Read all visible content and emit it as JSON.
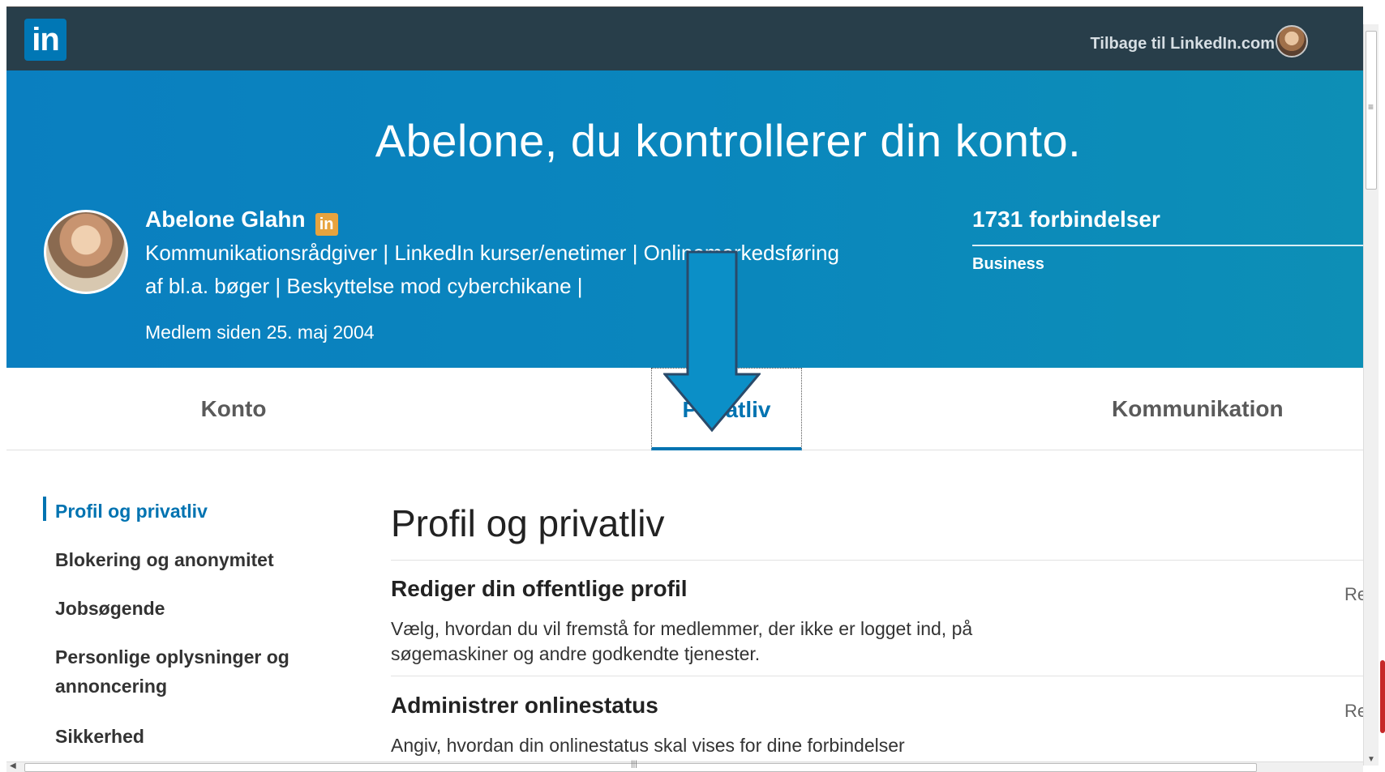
{
  "nav": {
    "logo_text": "in",
    "back_link": "Tilbage til LinkedIn.com",
    "avatar_icon": "user-avatar"
  },
  "hero": {
    "title": "Abelone, du kontrollerer din konto.",
    "name": "Abelone Glahn",
    "badge_text": "in",
    "headline_line1": "Kommunikationsrådgiver | LinkedIn kurser/enetimer | Onlinemarkedsføring",
    "headline_line2": "af bl.a. bøger | Beskyttelse mod cyberchikane |",
    "member_since": "Medlem siden 25. maj 2004",
    "connections": "1731 forbindelser",
    "account_type": "Business"
  },
  "tabs": [
    {
      "label": "Konto"
    },
    {
      "label": "Privatliv"
    },
    {
      "label": "Kommunikation"
    }
  ],
  "sidebar": {
    "items": [
      {
        "label": "Profil og privatliv"
      },
      {
        "label": "Blokering og anonymitet"
      },
      {
        "label": "Jobsøgende"
      },
      {
        "label": "Personlige oplysninger og annoncering"
      },
      {
        "label": "Sikkerhed"
      }
    ]
  },
  "main": {
    "title": "Profil og privatliv",
    "sections": [
      {
        "title": "Rediger din offentlige profil",
        "description": "Vælg, hvordan du vil fremstå for medlemmer, der ikke er logget ind, på søgemaskiner og andre godkendte tjenester.",
        "action": "Re"
      },
      {
        "title": "Administrer onlinestatus",
        "description": "Angiv, hvordan din onlinestatus skal vises for dine forbindelser",
        "action": "Re"
      }
    ]
  },
  "colors": {
    "nav_bg": "#283e4a",
    "hero_bg": "#0a7fc0",
    "accent": "#0073b1",
    "badge": "#e7a33e",
    "arrow": "#0b8fc7"
  }
}
